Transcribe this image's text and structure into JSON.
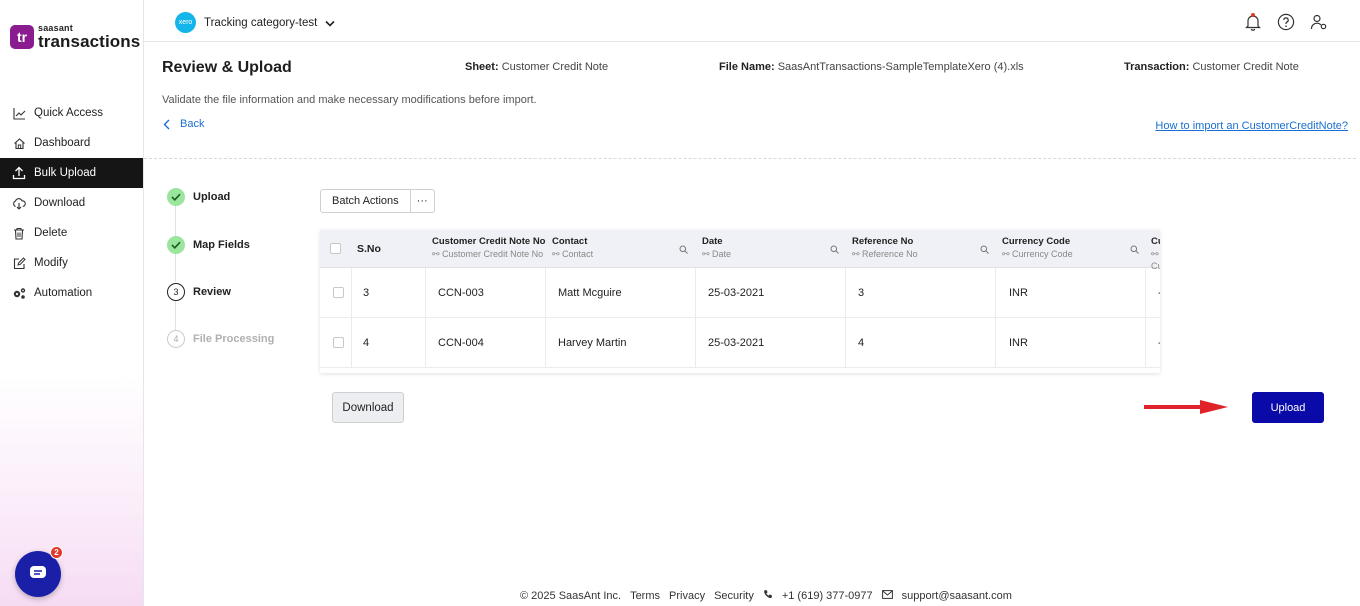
{
  "brand": {
    "mark": "tr",
    "small": "saasant",
    "big": "transactions"
  },
  "sidebar": {
    "items": [
      {
        "label": "Quick Access",
        "icon": "chart-line-icon"
      },
      {
        "label": "Dashboard",
        "icon": "home-icon"
      },
      {
        "label": "Bulk Upload",
        "icon": "upload-icon",
        "active": true
      },
      {
        "label": "Download",
        "icon": "cloud-download-icon"
      },
      {
        "label": "Delete",
        "icon": "trash-icon"
      },
      {
        "label": "Modify",
        "icon": "edit-icon"
      },
      {
        "label": "Automation",
        "icon": "gears-icon"
      }
    ],
    "chat_badge": "2"
  },
  "topbar": {
    "org_logo": "xero",
    "org_name": "Tracking category-test",
    "icons": [
      "bell-icon",
      "help-icon",
      "user-settings-icon"
    ]
  },
  "page": {
    "title": "Review & Upload",
    "sheet_label": "Sheet:",
    "sheet_value": "Customer Credit Note",
    "file_label": "File Name:",
    "file_value": "SaasAntTransactions-SampleTemplateXero (4).xls",
    "transaction_label": "Transaction:",
    "transaction_value": "Customer Credit Note",
    "subtitle": "Validate the file information and make necessary modifications before import.",
    "back": "Back",
    "help_link": "How to import an CustomerCreditNote?"
  },
  "steps": [
    {
      "num": "",
      "label": "Upload",
      "state": "done"
    },
    {
      "num": "",
      "label": "Map Fields",
      "state": "done"
    },
    {
      "num": "3",
      "label": "Review",
      "state": "current"
    },
    {
      "num": "4",
      "label": "File Processing",
      "state": "todo"
    }
  ],
  "batch": {
    "label": "Batch Actions",
    "more": "···"
  },
  "table": {
    "columns": [
      {
        "title": "S.No",
        "sub": ""
      },
      {
        "title": "Customer Credit Note No",
        "sub": "Customer Credit Note No"
      },
      {
        "title": "Contact",
        "sub": "Contact"
      },
      {
        "title": "Date",
        "sub": "Date"
      },
      {
        "title": "Reference No",
        "sub": "Reference No"
      },
      {
        "title": "Currency Code",
        "sub": "Currency Code"
      },
      {
        "title": "Cu",
        "sub": "Cu"
      }
    ],
    "rows": [
      [
        "3",
        "CCN-003",
        "Matt Mcguire",
        "25-03-2021",
        "3",
        "INR",
        "-"
      ],
      [
        "4",
        "CCN-004",
        "Harvey Martin",
        "25-03-2021",
        "4",
        "INR",
        "-"
      ]
    ]
  },
  "buttons": {
    "download": "Download",
    "upload": "Upload"
  },
  "colors": {
    "primary": "#0a0aa8",
    "brand": "#8a1c8f",
    "link": "#1a6fd1",
    "step_done": "#9be59d",
    "arrow": "#e0232a"
  },
  "footer": {
    "copyright": "© 2025 SaasAnt Inc.",
    "terms": "Terms",
    "privacy": "Privacy",
    "security": "Security",
    "phone": "+1 (619) 377-0977",
    "email": "support@saasant.com"
  }
}
